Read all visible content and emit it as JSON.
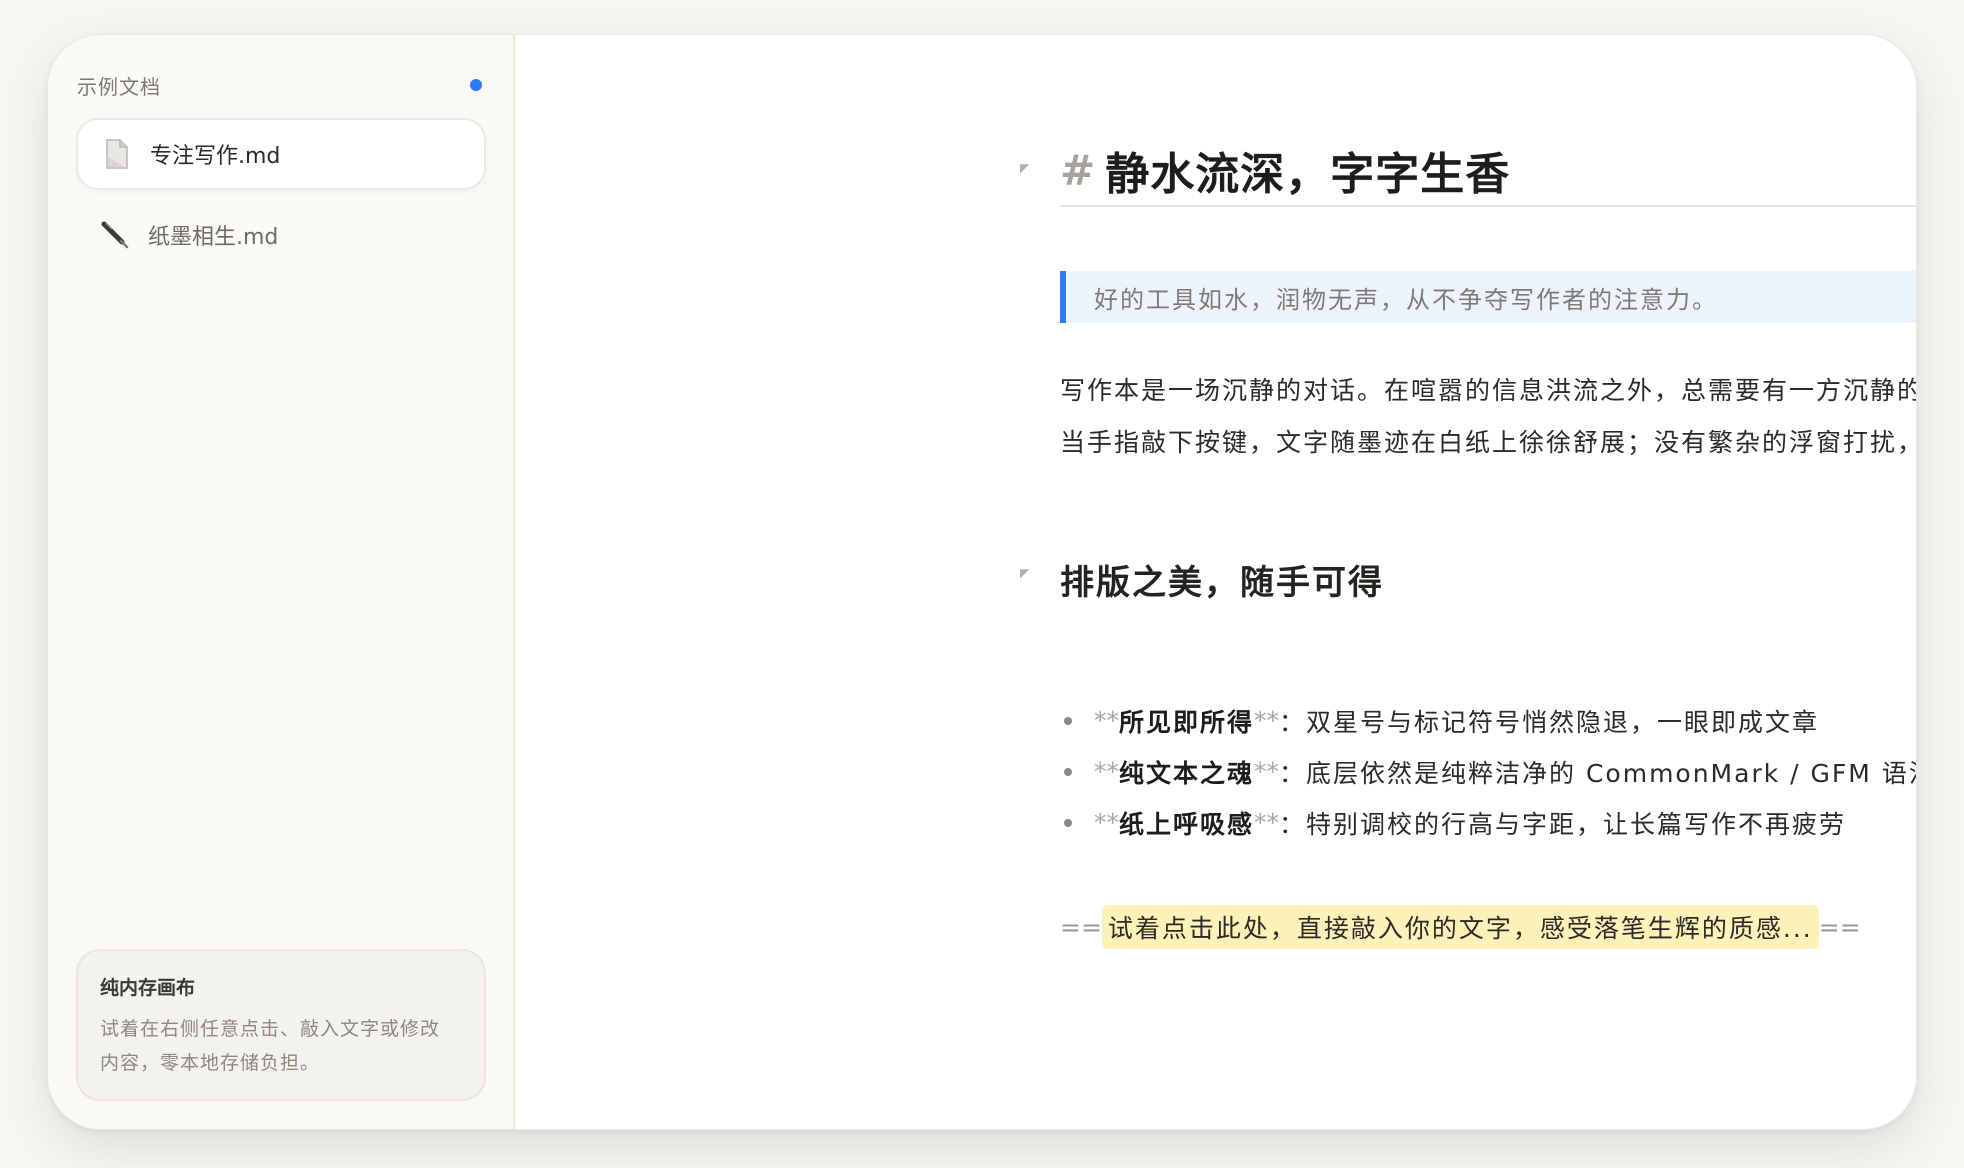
{
  "sidebar": {
    "title": "示例文档",
    "status_color": "#2f7bf5",
    "files": [
      {
        "name": "专注写作.md",
        "icon": "document-icon",
        "active": true
      },
      {
        "name": "纸墨相生.md",
        "icon": "pen-icon",
        "active": false
      }
    ],
    "info_card": {
      "title": "纯内存画布",
      "text_line1": "试着在右侧任意点击、敲入文字或修改",
      "text_line2": "内容，零本地存储负担。"
    }
  },
  "editor": {
    "heading1": {
      "mark": "#",
      "text": "静水流深，字字生香"
    },
    "blockquote": "好的工具如水，润物无声，从不争夺写作者的注意力。",
    "paragraph": {
      "line1": "写作本是一场沉静的对话。在喧嚣的信息洪流之外，总需要有一方沉静的书桌。",
      "line2": "当手指敲下按键，文字随墨迹在白纸上徐徐舒展；没有繁杂的浮窗打扰，只有光标在呼吸。"
    },
    "heading2": "排版之美，随手可得",
    "list": [
      {
        "mark": "**",
        "bold": "所见即所得",
        "rest": "：双星号与标记符号悄然隐退，一眼即成文章"
      },
      {
        "mark": "**",
        "bold": "纯文本之魂",
        "rest": "：底层依然是纯粹洁净的 CommonMark / GFM 语法"
      },
      {
        "mark": "**",
        "bold": "纸上呼吸感",
        "rest": "：特别调校的行高与字距，让长篇写作不再疲劳"
      }
    ],
    "highlight": {
      "mark": "==",
      "text": "试着点击此处，直接敲入你的文字，感受落笔生辉的质感..."
    },
    "accent_color": "#2f7bf5",
    "highlight_color": "#fcf1b8"
  }
}
